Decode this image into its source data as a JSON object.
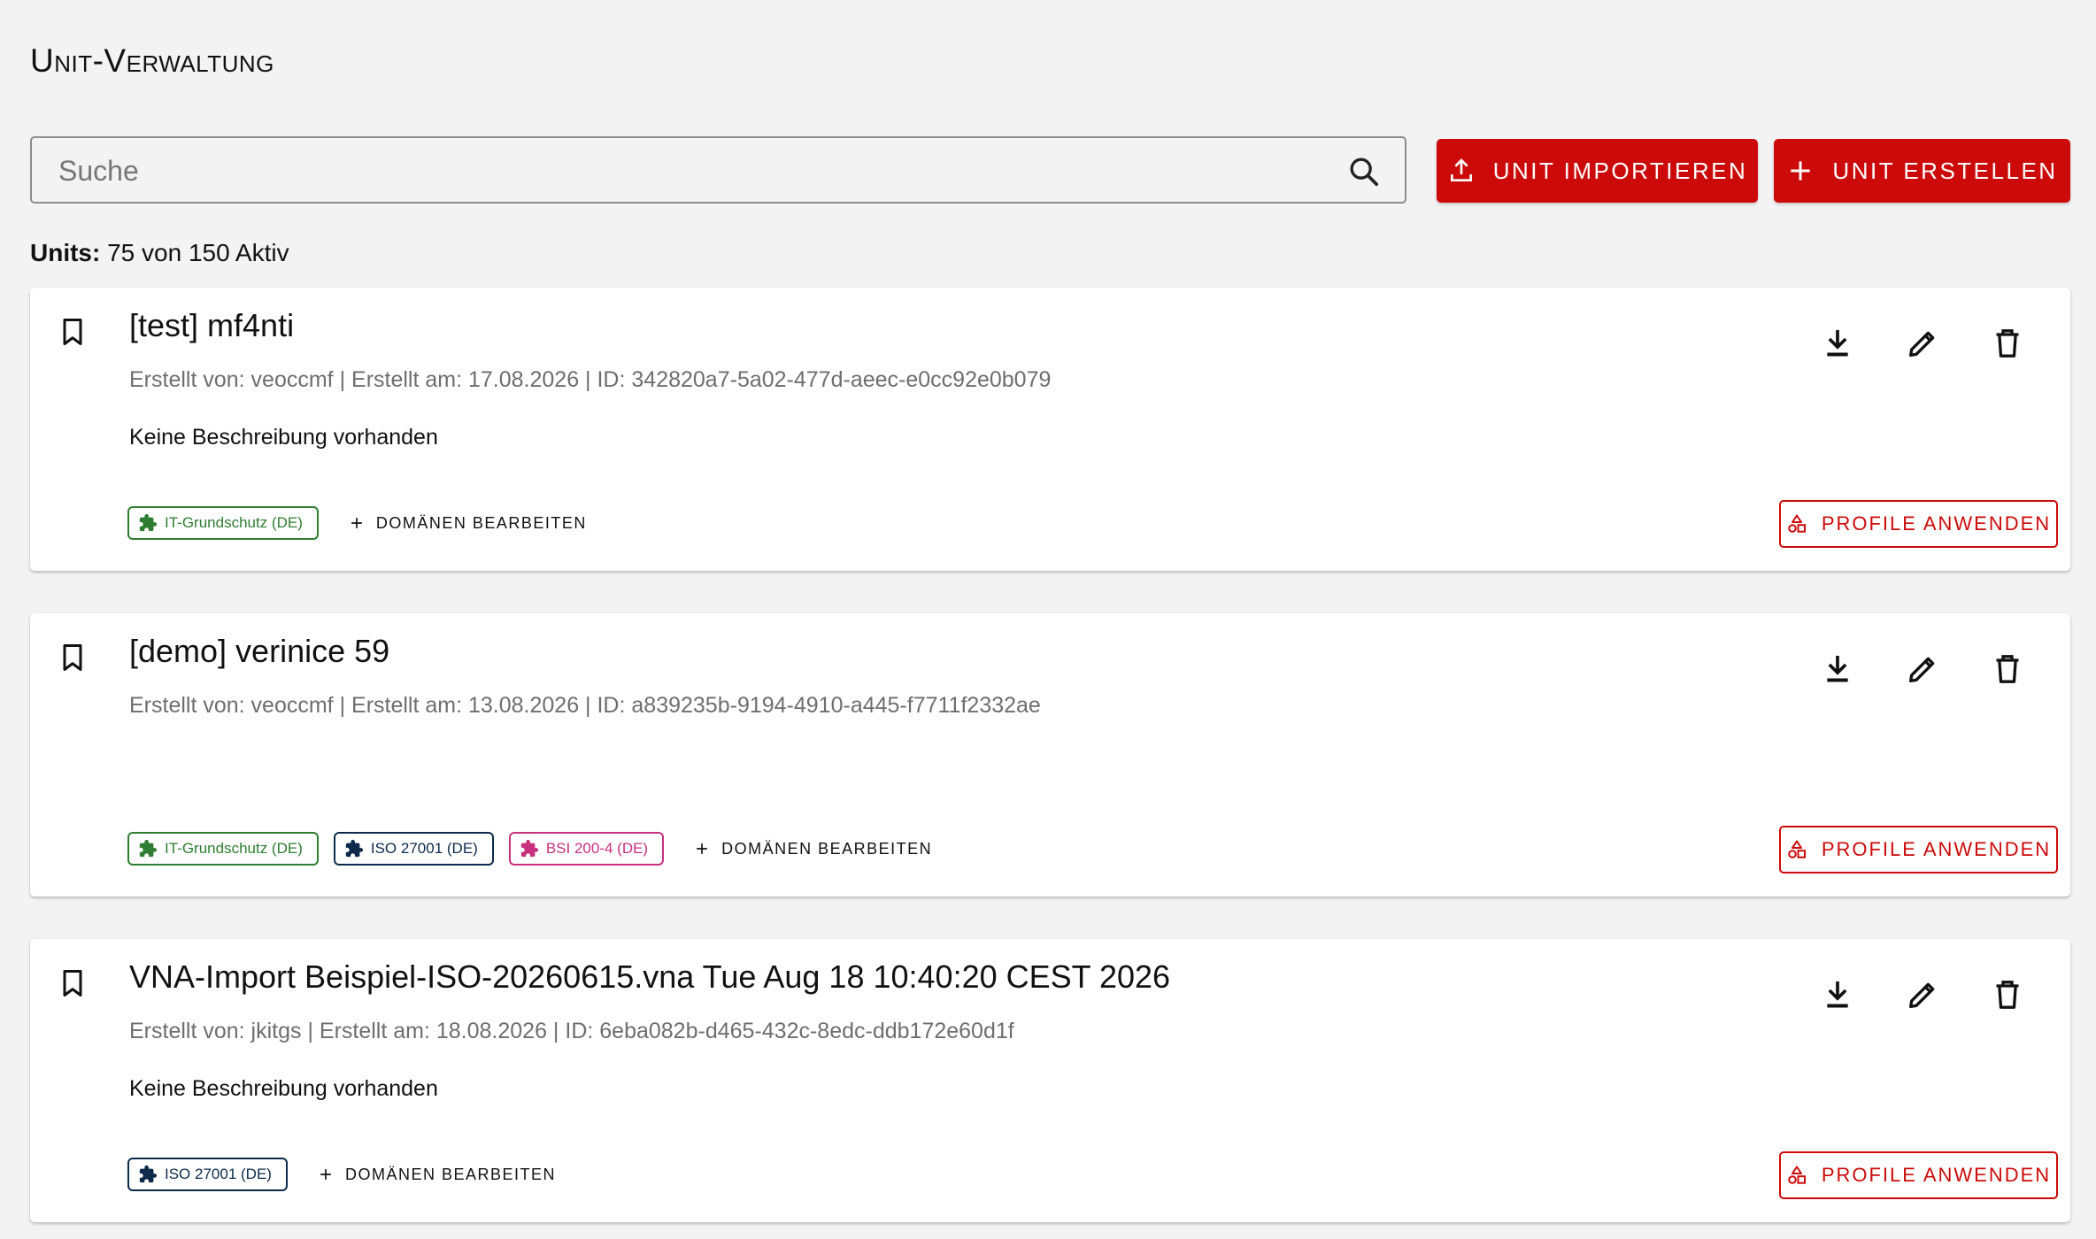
{
  "page": {
    "title": "Unit-Verwaltung"
  },
  "toolbar": {
    "search_placeholder": "Suche",
    "search_value": "",
    "import_label": "UNIT IMPORTIEREN",
    "create_label": "UNIT ERSTELLEN"
  },
  "summary": {
    "label": "Units:",
    "text": "75 von 150 Aktiv"
  },
  "units": [
    {
      "title": "[test] mf4nti",
      "meta": "Erstellt von: veoccmf | Erstellt am: 17.08.2026 | ID: 342820a7-5a02-477d-aeec-e0cc92e0b079",
      "description": "Keine Beschreibung vorhanden",
      "domains": [
        {
          "label": "IT-Grundschutz (DE)",
          "color": "#2e7d32"
        }
      ],
      "edit_domains_label": "DOMÄNEN BEARBEITEN",
      "apply_profiles_label": "PROFILE ANWENDEN"
    },
    {
      "title": "[demo] verinice 59",
      "meta": "Erstellt von: veoccmf | Erstellt am: 13.08.2026 | ID: a839235b-9194-4910-a445-f7711f2332ae",
      "description": "",
      "domains": [
        {
          "label": "IT-Grundschutz (DE)",
          "color": "#2e7d32"
        },
        {
          "label": "ISO 27001 (DE)",
          "color": "#0d2a4a"
        },
        {
          "label": "BSI 200-4 (DE)",
          "color": "#c8307e"
        }
      ],
      "edit_domains_label": "DOMÄNEN BEARBEITEN",
      "apply_profiles_label": "PROFILE ANWENDEN"
    },
    {
      "title": "VNA-Import Beispiel-ISO-20260615.vna Tue Aug 18 10:40:20 CEST 2026",
      "meta": "Erstellt von: jkitgs | Erstellt am: 18.08.2026 | ID: 6eba082b-d465-432c-8edc-ddb172e60d1f",
      "description": "Keine Beschreibung vorhanden",
      "domains": [
        {
          "label": "ISO 27001 (DE)",
          "color": "#0d2a4a"
        }
      ],
      "edit_domains_label": "DOMÄNEN BEARBEITEN",
      "apply_profiles_label": "PROFILE ANWENDEN"
    }
  ],
  "icons": {
    "search": "search-icon",
    "import": "upload-icon",
    "create": "plus-icon",
    "bookmark": "bookmark-icon",
    "download": "download-icon",
    "edit": "pencil-icon",
    "delete": "trash-icon",
    "domain": "puzzle-icon",
    "profiles": "shapes-icon"
  },
  "colors": {
    "accent": "#cc0a0a",
    "background": "#f3f3f3"
  }
}
